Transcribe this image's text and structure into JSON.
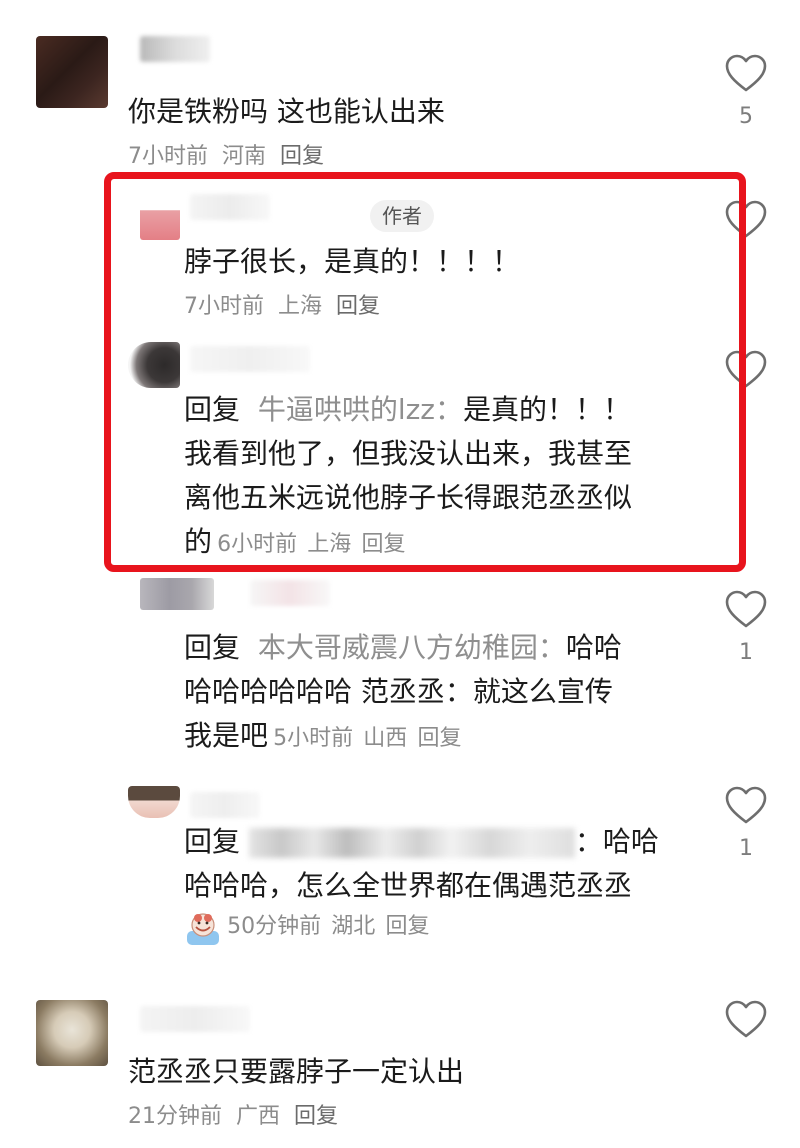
{
  "comments": [
    {
      "text": "你是铁粉吗 这也能认出来",
      "time": "7小时前",
      "location": "河南",
      "reply_label": "回复",
      "likes": "5"
    },
    {
      "author_tag": "作者",
      "text": "脖子很长，是真的！！！！",
      "time": "7小时前",
      "location": "上海",
      "reply_label": "回复"
    },
    {
      "reply_prefix": "回复",
      "reply_to": "牛逼哄哄的lzz：",
      "text_line1_rest": "是真的！！！",
      "text_line2": "我看到他了，但我没认出来，我甚至",
      "text_line3": "离他五米远说他脖子长得跟范丞丞似",
      "text_line4": "的",
      "time": "6小时前",
      "location": "上海",
      "reply_label": "回复"
    },
    {
      "reply_prefix": "回复",
      "reply_to": "本大哥威震八方幼稚园：",
      "text_line1_rest": "哈哈",
      "text_line2": "哈哈哈哈哈哈 范丞丞：就这么宣传",
      "text_line3": "我是吧",
      "time": "5小时前",
      "location": "山西",
      "reply_label": "回复",
      "likes": "1"
    },
    {
      "reply_prefix": "回复",
      "text_line1_rest": "：哈哈",
      "text_line2": "哈哈哈，怎么全世界都在偶遇范丞丞",
      "time": "50分钟前",
      "location": "湖北",
      "reply_label": "回复",
      "likes": "1"
    },
    {
      "text": "范丞丞只要露脖子一定认出",
      "time": "21分钟前",
      "location": "广西",
      "reply_label": "回复"
    }
  ],
  "colors": {
    "highlight": "#e8141d",
    "meta": "#8c8c8c",
    "reply_name": "#8f8f8f"
  }
}
